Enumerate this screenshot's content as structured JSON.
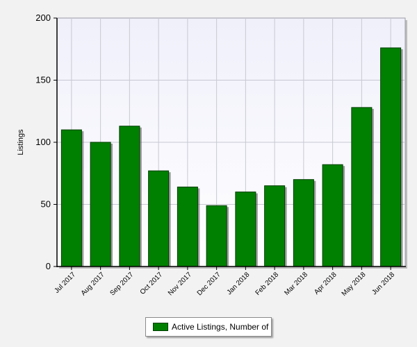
{
  "colors": {
    "bar": "#008000",
    "bar_edge": "#003d00",
    "plot_bg_top": "#f0f0fb",
    "plot_bg_bottom": "#ffffff",
    "grid": "#c8c8d2"
  },
  "chart_data": {
    "type": "bar",
    "title": "",
    "xlabel": "",
    "ylabel": "Listings",
    "ylim": [
      0,
      200
    ],
    "yticks": [
      "0",
      "50",
      "100",
      "150",
      "200"
    ],
    "grid": true,
    "legend_position": "bottom-center",
    "categories": [
      "Jul 2017",
      "Aug 2017",
      "Sep 2017",
      "Oct 2017",
      "Nov 2017",
      "Dec 2017",
      "Jan 2018",
      "Feb 2018",
      "Mar 2018",
      "Apr 2018",
      "May 2018",
      "Jun 2018"
    ],
    "series": [
      {
        "name": "Active Listings, Number of",
        "values": [
          110,
          100,
          113,
          77,
          64,
          49,
          60,
          65,
          70,
          82,
          128,
          176
        ]
      }
    ]
  }
}
